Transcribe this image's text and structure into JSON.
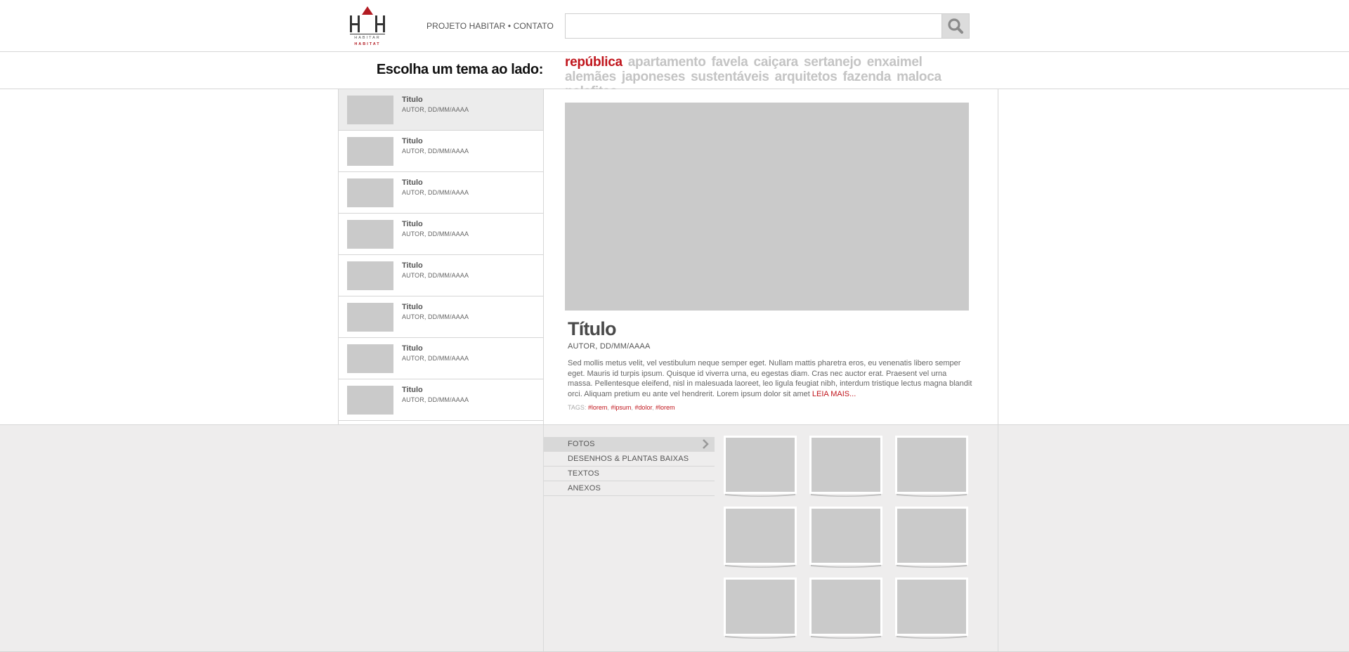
{
  "header": {
    "logo_text_top": "HABITAR",
    "logo_text_bottom": "HABITAT",
    "nav": {
      "projeto": "PROJETO HABITAR",
      "separator": "•",
      "contato": "CONTATO"
    },
    "search": {
      "value": "",
      "placeholder": "",
      "icon": "search-icon"
    }
  },
  "topicbar": {
    "label": "Escolha um tema ao lado:",
    "topics": [
      "república",
      "apartamento",
      "favela",
      "caiçara",
      "sertanejo",
      "enxaimel",
      "alemães",
      "japoneses",
      "sustentáveis",
      "arquitetos",
      "fazenda",
      "maloca",
      "palafitas"
    ],
    "active_index": 0
  },
  "posts": [
    {
      "title": "Titulo",
      "meta": "AUTOR, DD/MM/AAAA"
    },
    {
      "title": "Titulo",
      "meta": "AUTOR, DD/MM/AAAA"
    },
    {
      "title": "Titulo",
      "meta": "AUTOR, DD/MM/AAAA"
    },
    {
      "title": "Titulo",
      "meta": "AUTOR, DD/MM/AAAA"
    },
    {
      "title": "Titulo",
      "meta": "AUTOR, DD/MM/AAAA"
    },
    {
      "title": "Titulo",
      "meta": "AUTOR, DD/MM/AAAA"
    },
    {
      "title": "Titulo",
      "meta": "AUTOR, DD/MM/AAAA"
    },
    {
      "title": "Titulo",
      "meta": "AUTOR, DD/MM/AAAA"
    }
  ],
  "article": {
    "title": "Título",
    "meta": "AUTOR, DD/MM/AAAA",
    "body": "Sed mollis metus velit, vel vestibulum neque semper eget. Nullam mattis pharetra eros, eu venenatis libero semper eget. Mauris id turpis ipsum. Quisque id viverra urna, eu egestas diam. Cras nec auctor erat. Praesent vel urna massa. Pellentesque eleifend, nisl in malesuada laoreet, leo ligula feugiat nibh, interdum tristique lectus magna blandit orci. Aliquam pretium eu ante vel hendrerit. Lorem ipsum dolor sit amet",
    "read_more": "LEIA MAIS...",
    "tags_label": "TAGS:",
    "tags": [
      "#lorem",
      "#ipsum",
      "#dolor",
      "#lorem"
    ]
  },
  "media_menu": {
    "items": [
      "FOTOS",
      "DESENHOS & PLANTAS BAIXAS",
      "TEXTOS",
      "ANEXOS"
    ],
    "active_index": 0
  },
  "gallery": {
    "count": 9
  },
  "colors": {
    "accent": "#c0151c",
    "placeholder": "#cacaca",
    "topic_inactive": "#c4c4c4",
    "bottom_bg": "#eeeded"
  }
}
